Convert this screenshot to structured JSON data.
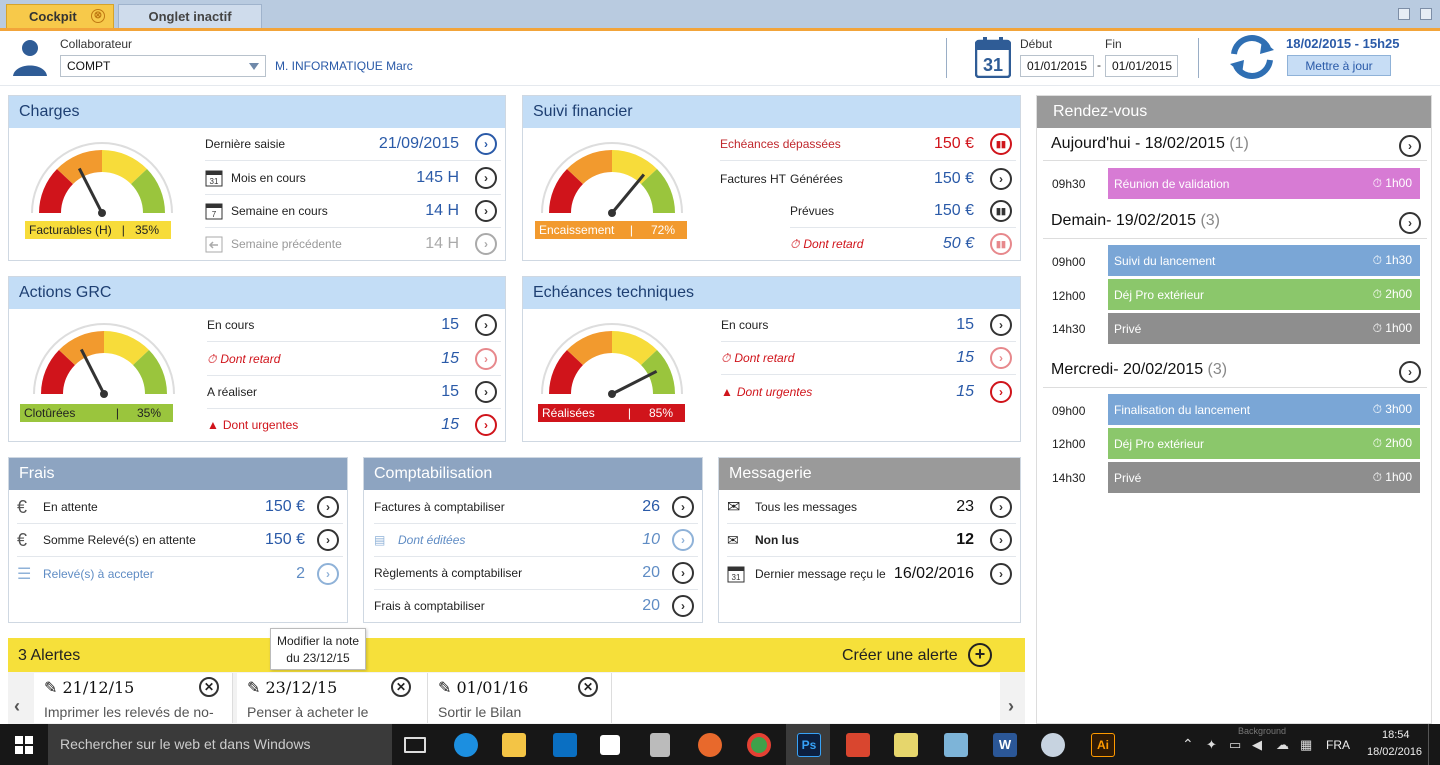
{
  "tabs": [
    {
      "label": "Cockpit",
      "active": true,
      "close": "⊗"
    },
    {
      "label": "Onglet inactif",
      "active": false
    }
  ],
  "header": {
    "collab_label": "Collaborateur",
    "collab_select": "COMPT",
    "collab_name": "M. INFORMATIQUE Marc",
    "cal_day": "31",
    "debut_label": "Début",
    "fin_label": "Fin",
    "debut_value": "01/01/2015",
    "fin_value": "01/01/2015",
    "range_dash": "-",
    "refresh_datetime": "18/02/2015 - 15h25",
    "update_button": "Mettre à jour"
  },
  "charges": {
    "title": "Charges",
    "gauge_label": "Facturables (H)",
    "gauge_pct": "35%",
    "gauge_fraction": 0.35,
    "rows": [
      {
        "label": "Dernière saisie",
        "value": "21/09/2015"
      },
      {
        "label": "Mois en cours",
        "value": "145 H",
        "icon_day": "31"
      },
      {
        "label": "Semaine en cours",
        "value": "14 H",
        "icon_day": "7"
      },
      {
        "label": "Semaine précédente",
        "value": "14 H"
      }
    ]
  },
  "suivi": {
    "title": "Suivi financier",
    "gauge_label": "Encaissement",
    "gauge_pct": "72%",
    "gauge_fraction": 0.72,
    "rows": [
      {
        "label": "Echéances dépassées",
        "value": "150 €"
      },
      {
        "label": "Factures HT",
        "sublabel": "Générées",
        "value": "150 €"
      },
      {
        "label": "Prévues",
        "value": "150 €"
      },
      {
        "label": "Dont retard",
        "value": "50 €"
      }
    ]
  },
  "grc": {
    "title": "Actions GRC",
    "gauge_label": "Clotûrées",
    "gauge_pct": "35%",
    "gauge_fraction": 0.35,
    "rows": [
      {
        "label": "En cours",
        "value": "15"
      },
      {
        "label": "Dont retard",
        "value": "15"
      },
      {
        "label": "A réaliser",
        "value": "15"
      },
      {
        "label": "Dont urgentes",
        "value": "15"
      }
    ]
  },
  "tech": {
    "title": "Echéances techniques",
    "gauge_label": "Réalisées",
    "gauge_pct": "85%",
    "gauge_fraction": 0.85,
    "rows": [
      {
        "label": "En cours",
        "value": "15"
      },
      {
        "label": "Dont retard",
        "value": "15"
      },
      {
        "label": "Dont urgentes",
        "value": "15"
      }
    ]
  },
  "frais": {
    "title": "Frais",
    "rows": [
      {
        "label": "En attente",
        "value": "150 €"
      },
      {
        "label": "Somme Relevé(s) en attente",
        "value": "150 €"
      },
      {
        "label": "Relevé(s) à accepter",
        "value": "2"
      }
    ]
  },
  "compta": {
    "title": "Comptabilisation",
    "rows": [
      {
        "label": "Factures à comptabiliser",
        "value": "26"
      },
      {
        "label": "Dont éditées",
        "value": "10"
      },
      {
        "label": "Règlements à comptabiliser",
        "value": "20"
      },
      {
        "label": "Frais à comptabiliser",
        "value": "20"
      }
    ]
  },
  "messagerie": {
    "title": "Messagerie",
    "rows": [
      {
        "label": "Tous les messages",
        "value": "23"
      },
      {
        "label": "Non lus",
        "value": "12"
      },
      {
        "label": "Dernier message reçu le",
        "value": "16/02/2016",
        "icon_day": "31"
      }
    ]
  },
  "rdv": {
    "title": "Rendez-vous",
    "days": [
      {
        "label": "Aujourd'hui - 18/02/2015",
        "count": "(1)",
        "items": [
          {
            "time": "09h30",
            "title": "Réunion de validation",
            "dur": "1h00",
            "color": "#d77bd4"
          }
        ]
      },
      {
        "label": "Demain- 19/02/2015",
        "count": "(3)",
        "items": [
          {
            "time": "09h00",
            "title": "Suivi du lancement",
            "dur": "1h30",
            "color": "#7aa6d6"
          },
          {
            "time": "12h00",
            "title": "Déj Pro extérieur",
            "dur": "2h00",
            "color": "#8bc76b"
          },
          {
            "time": "14h30",
            "title": "Privé",
            "dur": "1h00",
            "color": "#8e8e8e"
          }
        ]
      },
      {
        "label": "Mercredi- 20/02/2015",
        "count": "(3)",
        "items": [
          {
            "time": "09h00",
            "title": "Finalisation du lancement",
            "dur": "3h00",
            "color": "#7aa6d6"
          },
          {
            "time": "12h00",
            "title": "Déj Pro extérieur",
            "dur": "2h00",
            "color": "#8bc76b"
          },
          {
            "time": "14h30",
            "title": "Privé",
            "dur": "1h00",
            "color": "#8e8e8e"
          }
        ]
      }
    ]
  },
  "alerts": {
    "title": "3 Alertes",
    "create": "Créer une alerte",
    "tooltip_line1": "Modifier la note",
    "tooltip_line2": "du 23/12/15",
    "prev": "‹",
    "next": "›",
    "items": [
      {
        "date": "21/12/15",
        "text": "Imprimer les relevés de no-"
      },
      {
        "date": "23/12/15",
        "text": "Penser à acheter le"
      },
      {
        "date": "01/01/16",
        "text": "Sortir le Bilan"
      }
    ]
  },
  "taskbar": {
    "search": "Rechercher sur le web et dans Windows",
    "lang": "FRA",
    "time": "18:54",
    "date": "18/02/2016",
    "ghost_text": "Background"
  },
  "colors": {
    "accent": "#f7c94a",
    "link_blue": "#2a5aa8",
    "alert_red": "#d0141b",
    "header_blue": "#c3ddf6"
  }
}
